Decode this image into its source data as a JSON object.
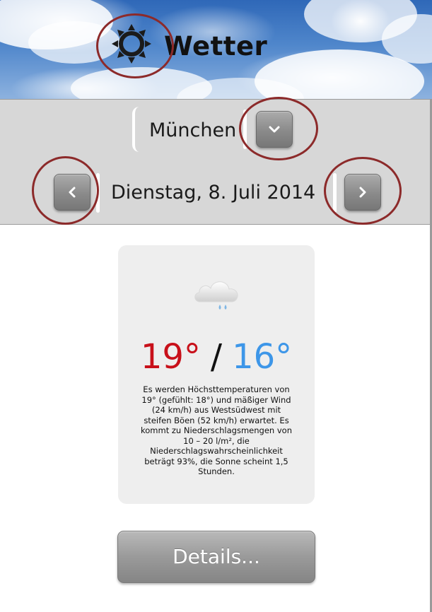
{
  "header": {
    "title": "Wetter",
    "logo_icon": "sun-icon"
  },
  "city_selector": {
    "selected": "München",
    "dropdown_icon": "chevron-down-icon"
  },
  "date_nav": {
    "date": "Dienstag, 8. Juli 2014",
    "prev_icon": "chevron-left-icon",
    "next_icon": "chevron-right-icon"
  },
  "forecast": {
    "icon": "cloud-rain-icon",
    "high": "19°",
    "separator": "/",
    "low": "16°",
    "high_color": "#c8101a",
    "low_color": "#3d96e8",
    "description": "Es werden Höchsttemperaturen von 19° (gefühlt: 18°) und mäßiger Wind (24 km/h) aus Westsüdwest mit steifen Böen (52 km/h) erwartet. Es kommt zu Niederschlagsmengen von 10 – 20 l/m², die Niederschlagswahrscheinlichkeit beträgt 93%, die Sonne scheint 1,5 Stunden."
  },
  "actions": {
    "details_label": "Details..."
  },
  "colors": {
    "highlight_ring": "#8c2a2a",
    "toolbar_bg": "#d7d7d7"
  }
}
